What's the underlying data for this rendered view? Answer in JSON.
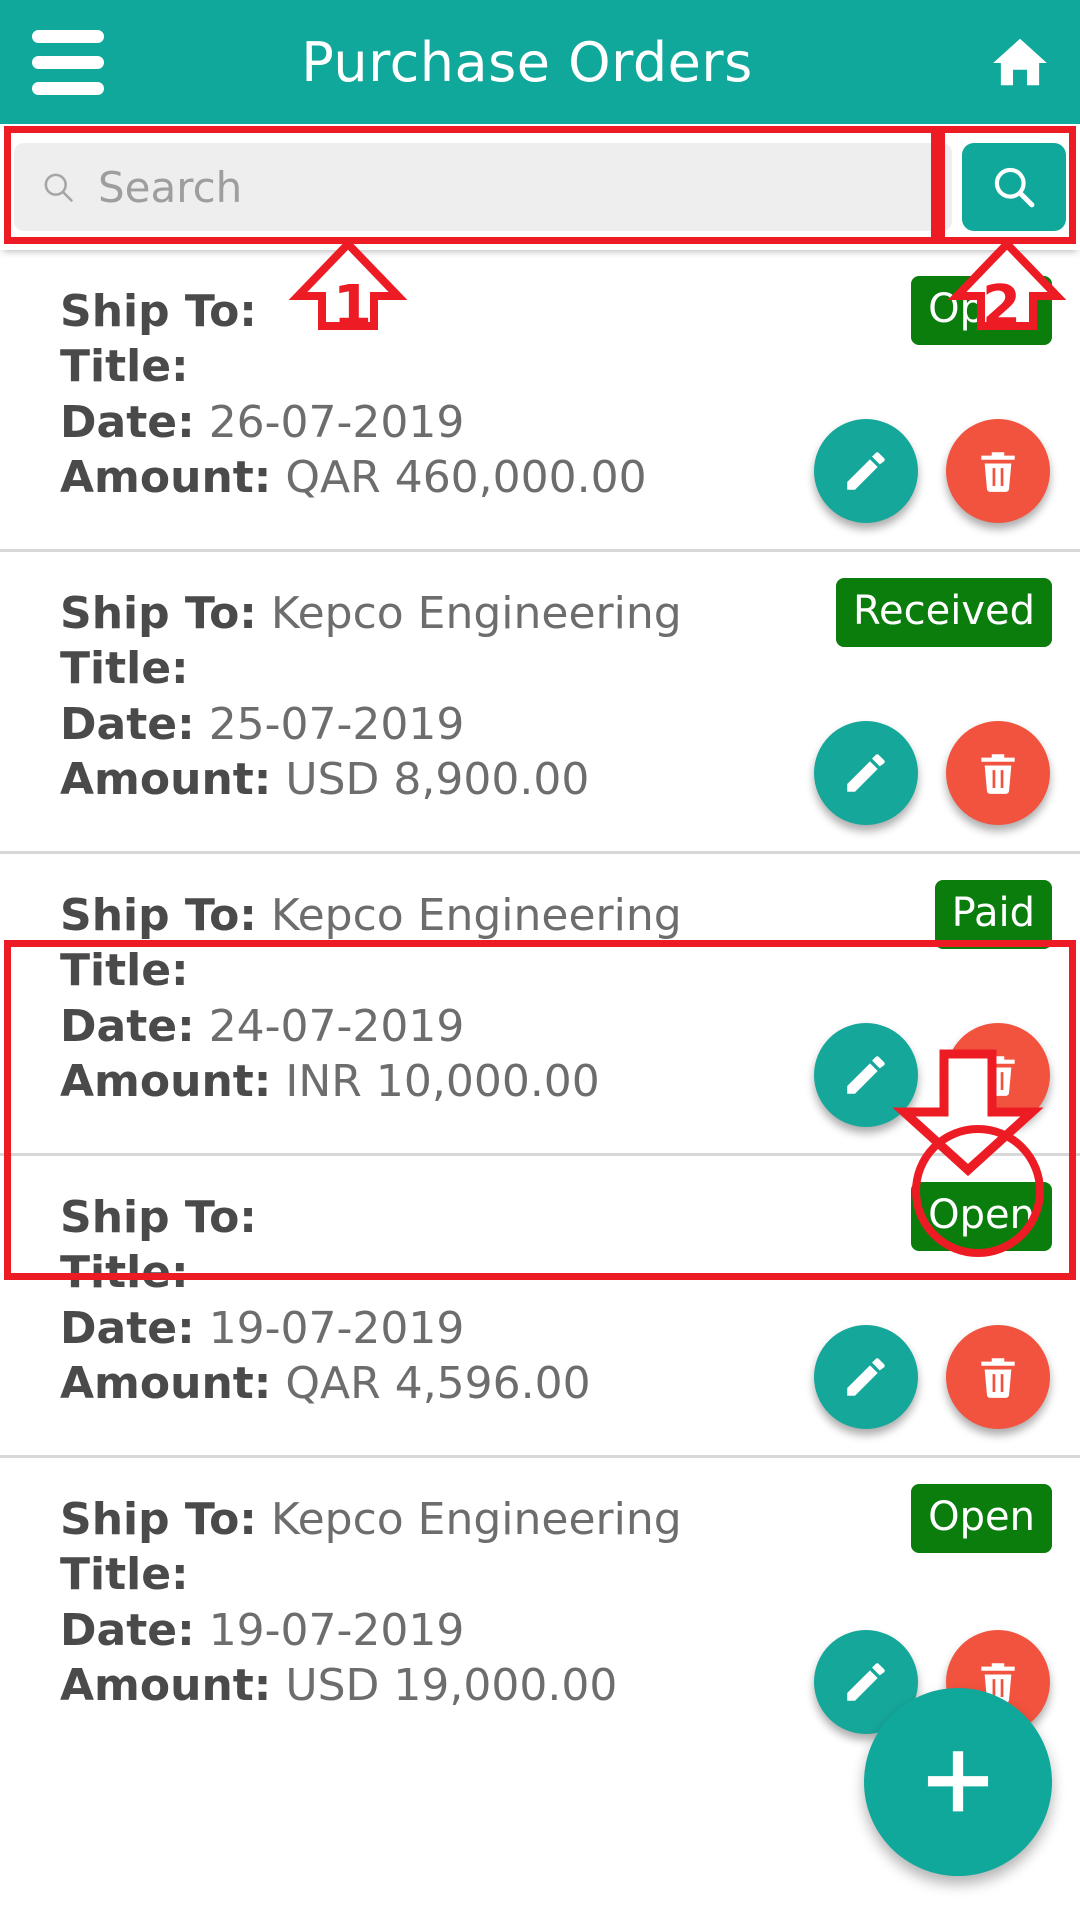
{
  "header": {
    "menu_icon": "hamburger-menu-icon",
    "title": "Purchase Orders",
    "home_icon": "home-icon"
  },
  "search": {
    "placeholder": "Search",
    "value": "",
    "field_icon": "search-icon",
    "button_icon": "search-icon"
  },
  "labels": {
    "ship_to": "Ship To:",
    "title": "Title:",
    "date": "Date:",
    "amount": "Amount:"
  },
  "orders": [
    {
      "ship_to": "",
      "title": "",
      "date": "26-07-2019",
      "amount": "QAR 460,000.00",
      "status": "Open",
      "edit_icon": "pencil-icon",
      "delete_icon": "trash-icon"
    },
    {
      "ship_to": "Kepco Engineering",
      "title": "",
      "date": "25-07-2019",
      "amount": "USD 8,900.00",
      "status": "Received",
      "edit_icon": "pencil-icon",
      "delete_icon": "trash-icon"
    },
    {
      "ship_to": "Kepco Engineering",
      "title": "",
      "date": "24-07-2019",
      "amount": "INR 10,000.00",
      "status": "Paid",
      "edit_icon": "pencil-icon",
      "delete_icon": "trash-icon"
    },
    {
      "ship_to": "",
      "title": "",
      "date": "19-07-2019",
      "amount": "QAR 4,596.00",
      "status": "Open",
      "edit_icon": "pencil-icon",
      "delete_icon": "trash-icon"
    },
    {
      "ship_to": "Kepco Engineering",
      "title": "",
      "date": "19-07-2019",
      "amount": "USD 19,000.00",
      "status": "Open",
      "edit_icon": "pencil-icon",
      "delete_icon": "trash-icon"
    }
  ],
  "fab": {
    "icon": "plus-icon"
  },
  "annotations": {
    "step1": "1",
    "step2": "2"
  },
  "colors": {
    "accent_teal": "#10a89b",
    "status_green": "#0a7d0c",
    "delete_red": "#f2533e",
    "annotation_red": "#ed1c24",
    "search_field_bg": "#eeeeee"
  }
}
